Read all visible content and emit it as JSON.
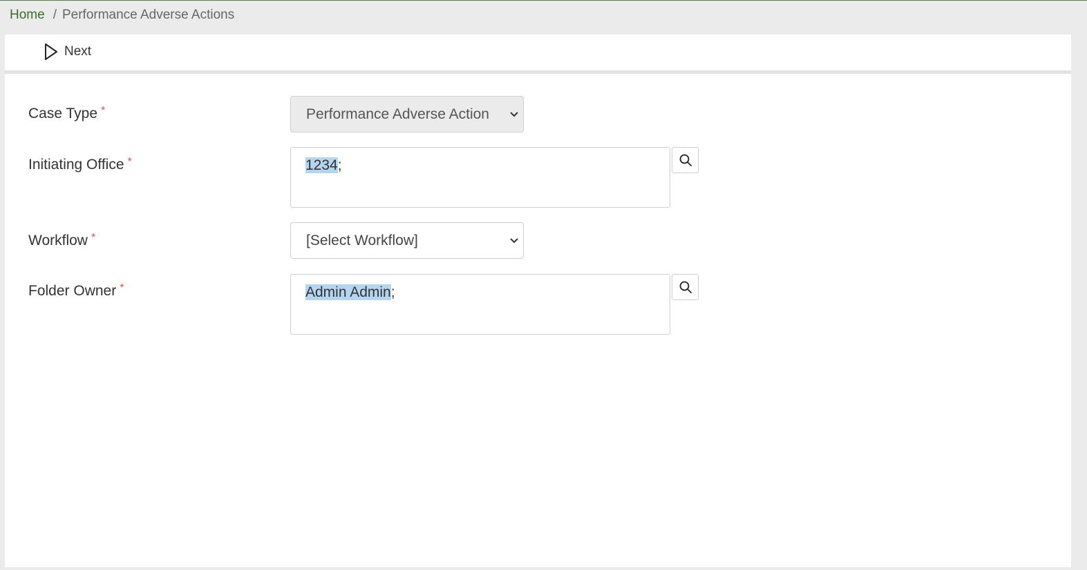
{
  "breadcrumb": {
    "home": "Home",
    "separator": "/",
    "current": "Performance Adverse Actions"
  },
  "toolbar": {
    "next_label": "Next",
    "next_icon": "play-outline-icon"
  },
  "form": {
    "required_marker": "*",
    "case_type": {
      "label": "Case Type",
      "value": "Performance Adverse Action",
      "disabled": true
    },
    "initiating_office": {
      "label": "Initiating Office",
      "value_highlighted": "1234",
      "value_suffix": ";",
      "search_icon": "search-icon"
    },
    "workflow": {
      "label": "Workflow",
      "value": "[Select Workflow]"
    },
    "folder_owner": {
      "label": "Folder Owner",
      "value_highlighted": "Admin Admin",
      "value_suffix": ";",
      "search_icon": "search-icon"
    }
  },
  "colors": {
    "link_green": "#3b6b2f",
    "required_red": "#d9534f",
    "selection_blue": "#b4d5f0",
    "page_bg": "#ebebeb"
  }
}
